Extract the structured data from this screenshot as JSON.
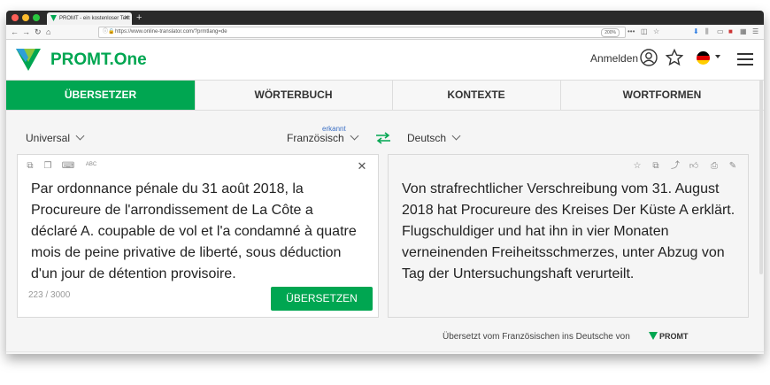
{
  "browser": {
    "tab_title": "PROMT - ein kostenloser Text",
    "url": "https://www.online-translator.com/?prmtlang=de",
    "zoom": "200%",
    "menu_dots": "•••"
  },
  "header": {
    "brand": "PROMT.One",
    "signin_label": "Anmelden"
  },
  "nav": {
    "tabs": [
      {
        "label": "ÜBERSETZER",
        "active": true
      },
      {
        "label": "WÖRTERBUCH",
        "active": false
      },
      {
        "label": "KONTEXTE",
        "active": false
      },
      {
        "label": "WORTFORMEN",
        "active": false
      }
    ]
  },
  "languages": {
    "topic": "Universal",
    "detected_note": "erkannt",
    "source": "Französisch",
    "target": "Deutsch"
  },
  "source_panel": {
    "text": "Par ordonnance pénale du 31 août 2018, la Procureure de l'arrondissement de La Côte a déclaré A. coupable de vol et l'a condamné à quatre mois de peine privative de liberté, sous déduction d'un jour de détention provisoire.",
    "char_count": "223 / 3000",
    "translate_button": "ÜBERSETZEN",
    "spellcheck_label": "ABC"
  },
  "target_panel": {
    "text": "Von strafrechtlicher Verschreibung vom 31. August 2018 hat Procureure des Kreises Der Küste A erklärt. Flugschuldiger und hat ihn in vier Monaten verneinenden Freiheitsschmerzes, unter Abzug von Tag der Untersuchungshaft verurteilt."
  },
  "credit": {
    "text": "Übersetzt vom Französischen ins Deutsche von",
    "brand": "PROMT"
  },
  "colors": {
    "accent": "#00a651",
    "link": "#3a6fc4"
  }
}
